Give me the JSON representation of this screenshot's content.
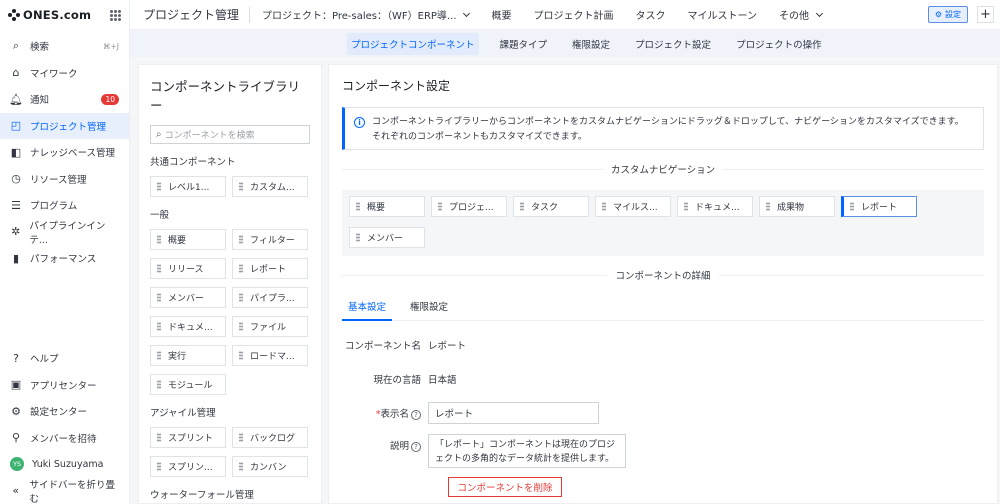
{
  "sidebar": {
    "logo": "ONES.com",
    "items": [
      {
        "label": "検索",
        "shortcut": "⌘+J",
        "icon": "search-icon"
      },
      {
        "label": "マイワーク",
        "icon": "home-icon"
      },
      {
        "label": "通知",
        "badge": "10",
        "icon": "bell-icon"
      },
      {
        "label": "プロジェクト管理",
        "icon": "project-icon",
        "active": true
      },
      {
        "label": "ナレッジベース管理",
        "icon": "knowledge-icon"
      },
      {
        "label": "リソース管理",
        "icon": "clock-icon"
      },
      {
        "label": "プログラム",
        "icon": "program-icon"
      },
      {
        "label": "パイプラインインテ...",
        "icon": "pipeline-icon"
      },
      {
        "label": "パフォーマンス",
        "icon": "chart-icon"
      }
    ],
    "bottom_items": [
      {
        "label": "ヘルプ",
        "icon": "help-icon"
      },
      {
        "label": "アプリセンター",
        "icon": "app-center-icon"
      },
      {
        "label": "設定センター",
        "icon": "gear-icon"
      },
      {
        "label": "メンバーを招待",
        "icon": "invite-icon"
      }
    ],
    "user": {
      "initials": "YS",
      "name": "Yuki Suzuyama"
    },
    "collapse_label": "サイドバーを折り畳む"
  },
  "topbar": {
    "title": "プロジェクト管理",
    "project_select": "プロジェクト：Pre-sales：（WF）ERP導...",
    "tabs": [
      "概要",
      "プロジェクト計画",
      "タスク",
      "マイルストーン",
      "その他"
    ],
    "settings_button": "設定"
  },
  "subnav": {
    "tabs": [
      "プロジェクトコンポーネント",
      "課題タイプ",
      "権限設定",
      "プロジェクト設定",
      "プロジェクトの操作"
    ],
    "active": "プロジェクトコンポーネント"
  },
  "library": {
    "title": "コンポーネントライブラリー",
    "search_placeholder": "コンポーネントを検索",
    "groups": [
      {
        "title": "共通コンポーネント",
        "items": [
          "レベル1...",
          "カスタム..."
        ]
      },
      {
        "title": "一般",
        "items": [
          "概要",
          "フィルター",
          "リリース",
          "レポート",
          "メンバー",
          "パイプラ...",
          "ドキュメ...",
          "ファイル",
          "実行",
          "ロードマ...",
          "モジュール"
        ]
      },
      {
        "title": "アジャイル管理",
        "items": [
          "スプリント",
          "バックログ",
          "スプリン...",
          "カンバン"
        ]
      },
      {
        "title": "ウォーターフォール管理",
        "items": []
      }
    ]
  },
  "settings": {
    "title": "コンポーネント設定",
    "info_line1": "コンポーネントライブラリーからコンポーネントをカスタムナビゲーションにドラッグ＆ドロップして、ナビゲーションをカスタマイズできます。",
    "info_line2": "それぞれのコンポーネントもカスタマイズできます。",
    "custom_nav_title": "カスタムナビゲーション",
    "custom_nav_items": [
      "概要",
      "プロジェ...",
      "タスク",
      "マイルス...",
      "ドキュメ...",
      "成果物",
      "レポート",
      "メンバー"
    ],
    "selected_nav_item": "レポート",
    "detail_title": "コンポーネントの詳細",
    "detail_tabs": [
      "基本設定",
      "権限設定"
    ],
    "active_detail_tab": "基本設定",
    "form": {
      "name_label": "コンポーネント名",
      "name_value": "レポート",
      "lang_label": "現在の言語",
      "lang_value": "日本語",
      "display_label": "表示名",
      "display_value": "レポート",
      "desc_label": "説明",
      "desc_value": "「レポート」コンポーネントは現在のプロジェクトの多角的なデータ統計を提供します。"
    },
    "delete_button": "コンポーネントを削除"
  }
}
